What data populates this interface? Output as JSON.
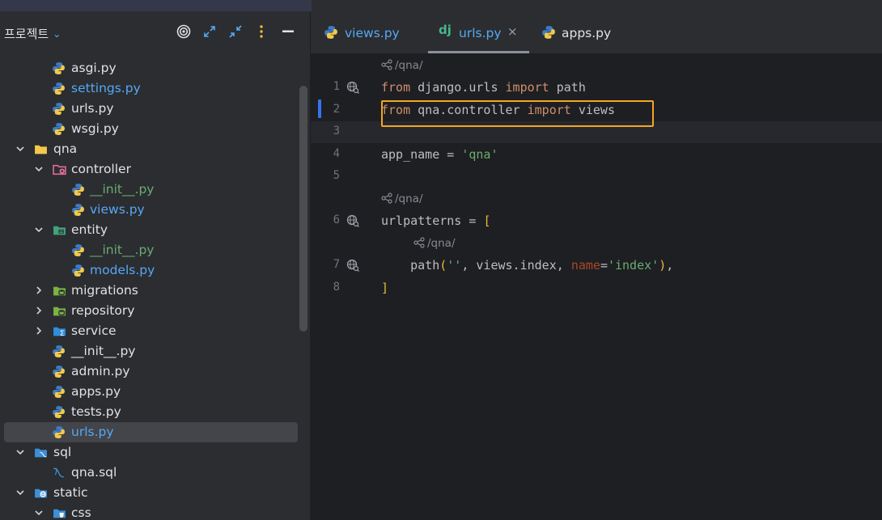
{
  "sidebar": {
    "title": "프로젝트",
    "tree": [
      {
        "label": "asgi.py",
        "type": "python",
        "status": "normal"
      },
      {
        "label": "settings.py",
        "type": "python",
        "status": "modified"
      },
      {
        "label": "urls.py",
        "type": "python",
        "status": "normal"
      },
      {
        "label": "wsgi.py",
        "type": "python",
        "status": "normal"
      },
      {
        "label": "qna",
        "type": "folder",
        "status": "normal",
        "expanded": true
      },
      {
        "label": "controller",
        "type": "folder-controller",
        "status": "normal",
        "expanded": true
      },
      {
        "label": "__init__.py",
        "type": "python",
        "status": "new"
      },
      {
        "label": "views.py",
        "type": "python",
        "status": "modified"
      },
      {
        "label": "entity",
        "type": "folder-entity",
        "status": "normal",
        "expanded": true
      },
      {
        "label": "__init__.py",
        "type": "python",
        "status": "new"
      },
      {
        "label": "models.py",
        "type": "python",
        "status": "modified"
      },
      {
        "label": "migrations",
        "type": "folder-db",
        "status": "normal",
        "expanded": false
      },
      {
        "label": "repository",
        "type": "folder-db",
        "status": "normal",
        "expanded": false
      },
      {
        "label": "service",
        "type": "folder-service",
        "status": "normal",
        "expanded": false
      },
      {
        "label": "__init__.py",
        "type": "python",
        "status": "normal"
      },
      {
        "label": "admin.py",
        "type": "python",
        "status": "normal"
      },
      {
        "label": "apps.py",
        "type": "python",
        "status": "normal"
      },
      {
        "label": "tests.py",
        "type": "python",
        "status": "normal"
      },
      {
        "label": "urls.py",
        "type": "python",
        "status": "modified",
        "selected": true
      },
      {
        "label": "sql",
        "type": "folder-sql",
        "status": "normal",
        "expanded": true
      },
      {
        "label": "qna.sql",
        "type": "sql",
        "status": "normal"
      },
      {
        "label": "static",
        "type": "folder-web",
        "status": "normal",
        "expanded": true
      },
      {
        "label": "css",
        "type": "folder-css",
        "status": "normal",
        "expanded": true
      }
    ]
  },
  "tabs": [
    {
      "label": "views.py",
      "icon": "python-icon",
      "active": false
    },
    {
      "label": "urls.py",
      "icon": "django-icon",
      "active": true,
      "close": "×"
    },
    {
      "label": "apps.py",
      "icon": "python-icon",
      "active": false
    }
  ],
  "editor": {
    "hints": [
      "/qna/",
      "/qna/",
      "/qna/"
    ],
    "line_numbers": [
      "1",
      "2",
      "3",
      "4",
      "5",
      "6",
      "7",
      "8"
    ],
    "code": {
      "l1": {
        "kw1": "from",
        "mod": " django.urls ",
        "kw2": "import",
        "name": " path"
      },
      "l2": {
        "kw1": "from",
        "mod": " qna.controller ",
        "kw2": "import",
        "name": " views"
      },
      "l4": {
        "lhs": "app_name = ",
        "str": "'qna'"
      },
      "l6": {
        "lhs": "urlpatterns = ",
        "br": "["
      },
      "l7": {
        "fn": "    path",
        "p1": "(",
        "s1": "''",
        "mid": ", views.index, ",
        "kwarg": "name",
        "eq": "=",
        "s2": "'index'",
        "p2": ")",
        "end": ","
      },
      "l8": {
        "br": "]"
      }
    }
  },
  "colors": {
    "keyword": "#cf8e6d",
    "string": "#6aab73",
    "bracket": "#e8ba36",
    "modified": "#56a8f5",
    "highlight_box": "#f5a623"
  }
}
